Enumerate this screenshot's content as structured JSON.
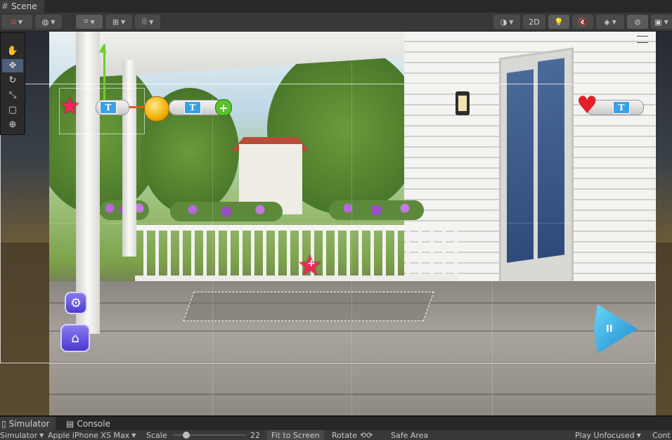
{
  "tabs": {
    "scene_label": "Scene",
    "scene_icon": "hash-icon"
  },
  "toolbar": {
    "draw_mode_icon": "shading-mode-icon",
    "gizmo_icon": "globe-icon",
    "grid_snap_icon": "grid-snap-icon",
    "increment_snap_icon": "increment-snap-icon",
    "ruler_icon": "ruler-icon",
    "render_mode_icon": "circle-shading-icon",
    "toggle_2d_label": "2D",
    "lighting_icon": "lightbulb-icon",
    "audio_icon": "audio-mute-icon",
    "effects_icon": "layers-icon",
    "visibility_icon": "hidden-eye-icon",
    "camera_icon": "camera-icon"
  },
  "tools": [
    {
      "name": "hand-tool",
      "icon": "✋"
    },
    {
      "name": "move-tool",
      "icon": "✥"
    },
    {
      "name": "rotate-tool",
      "icon": "↻"
    },
    {
      "name": "scale-tool",
      "icon": "⤡"
    },
    {
      "name": "rect-tool",
      "icon": "▢"
    },
    {
      "name": "transform-tool",
      "icon": "⊕"
    }
  ],
  "game_ui": {
    "t_text": "T",
    "plus_glyph": "+",
    "play_glyph": "II"
  },
  "bottom_tabs": {
    "simulator_label": "Simulator",
    "console_label": "Console"
  },
  "sim_bar": {
    "mode_label": "Simulator",
    "device_label": "Apple iPhone XS Max",
    "scale_label": "Scale",
    "scale_value": "22",
    "fit_label": "Fit to Screen",
    "rotate_label": "Rotate",
    "safe_area_label": "Safe Area",
    "play_label": "Play Unfocused",
    "control_label": "Cont"
  },
  "colors": {
    "selection": "#4d5e7a",
    "accent_green": "#6ad22a",
    "star_red": "#f0285a",
    "button_purple": "#5a4ae0",
    "play_blue": "#2aa8e0"
  }
}
